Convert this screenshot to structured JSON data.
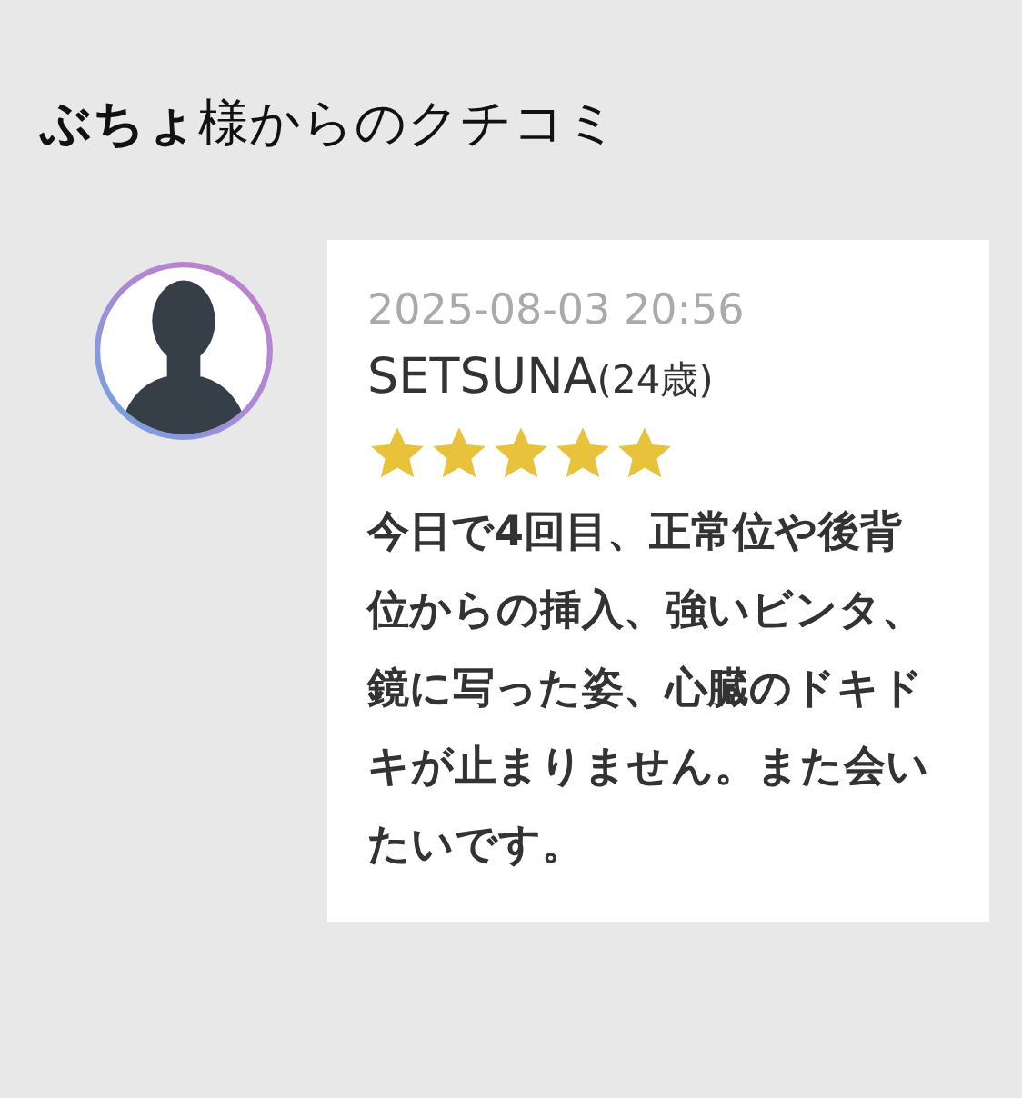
{
  "heading": "**ぶちょ**様からのクチコミ",
  "review": {
    "date": "2025-08-03 20:56",
    "name": "SETSUNA",
    "age": "(24歳)",
    "stars": 5,
    "text": "今日で4回目、正常位や後背位からの挿入、強いビンタ、鏡に写った姿、心臓のドキドキが止まりません。また会いたいです。"
  }
}
